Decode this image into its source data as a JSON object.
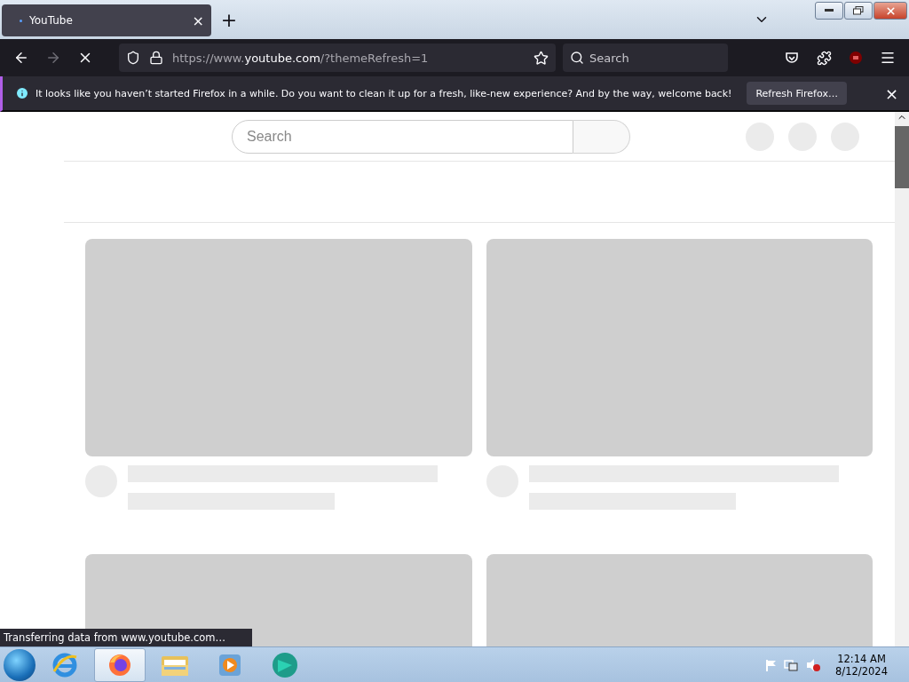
{
  "tabs": [
    {
      "title": "YouTube",
      "selected": true,
      "close": "×"
    }
  ],
  "new_tab": "+",
  "address_bar": {
    "prefix": "https://www.",
    "domain": "youtube.com",
    "suffix": "/?themeRefresh=1"
  },
  "toolbar_search": {
    "placeholder": "Search"
  },
  "notification": {
    "message": "It looks like you haven’t started Firefox in a while. Do you want to clean it up for a fresh, like-new experience? And by the way, welcome back!",
    "button": "Refresh Firefox…",
    "close": "×"
  },
  "page": {
    "search": {
      "placeholder": "Search"
    },
    "cards": [
      {
        "kind": "skeleton"
      },
      {
        "kind": "skeleton"
      },
      {
        "kind": "thumbnail_only"
      },
      {
        "kind": "thumbnail_only"
      }
    ]
  },
  "status_text": "Transferring data from www.youtube.com…",
  "taskbar": {
    "apps": [
      {
        "kind": "ie",
        "selected": false
      },
      {
        "kind": "firefox",
        "selected": true
      },
      {
        "kind": "explorer",
        "selected": false
      },
      {
        "kind": "media",
        "selected": false
      },
      {
        "kind": "app",
        "selected": false
      }
    ],
    "time": "12:14 AM",
    "date": "8/12/2024"
  }
}
